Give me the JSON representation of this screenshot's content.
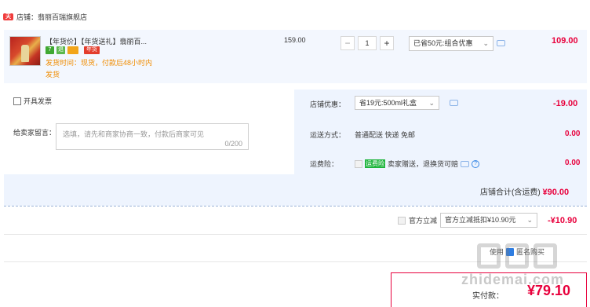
{
  "shop": {
    "icon": "shop-icon",
    "label": "店铺：翡丽百瑞旗舰店",
    "icon_text": "天猫"
  },
  "item": {
    "title": "【年货价】【年货送礼】翡丽百...",
    "badges": [
      "7",
      "退",
      "",
      "年货"
    ],
    "ship_note": "发货时间：现货，付款后48小时内发货",
    "unit_price": "159.00",
    "quantity": "1",
    "minus": "−",
    "plus": "+",
    "promo_select": "已省50元:组合优惠",
    "subtotal": "109.00"
  },
  "invoice": {
    "label": "开具发票"
  },
  "message": {
    "label": "给卖家留言：",
    "placeholder": "选填，请先和商家协商一致，付款后商家可见",
    "count": "0/200"
  },
  "store_discount": {
    "label": "店铺优惠：",
    "select": "省19元:500ml礼盒",
    "amount": "-19.00"
  },
  "shipping": {
    "label": "运送方式：",
    "value": "普通配送 快递 免邮",
    "amount": "0.00"
  },
  "insurance": {
    "label": "运费险：",
    "tag": "运费险",
    "text": "卖家赠送，退换货可赔",
    "help": "?",
    "amount": "0.00"
  },
  "store_total": {
    "label": "店铺合计(含运费)",
    "amount": "¥90.00"
  },
  "official": {
    "label": "官方立减",
    "select": "官方立减抵扣¥10.90元",
    "amount": "-¥10.90"
  },
  "anonymous": {
    "label": "匿名购买",
    "prefix": "使用"
  },
  "pay": {
    "label": "实付款：",
    "amount": "¥79.10"
  },
  "watermark": {
    "text": "zhidemai.com"
  }
}
